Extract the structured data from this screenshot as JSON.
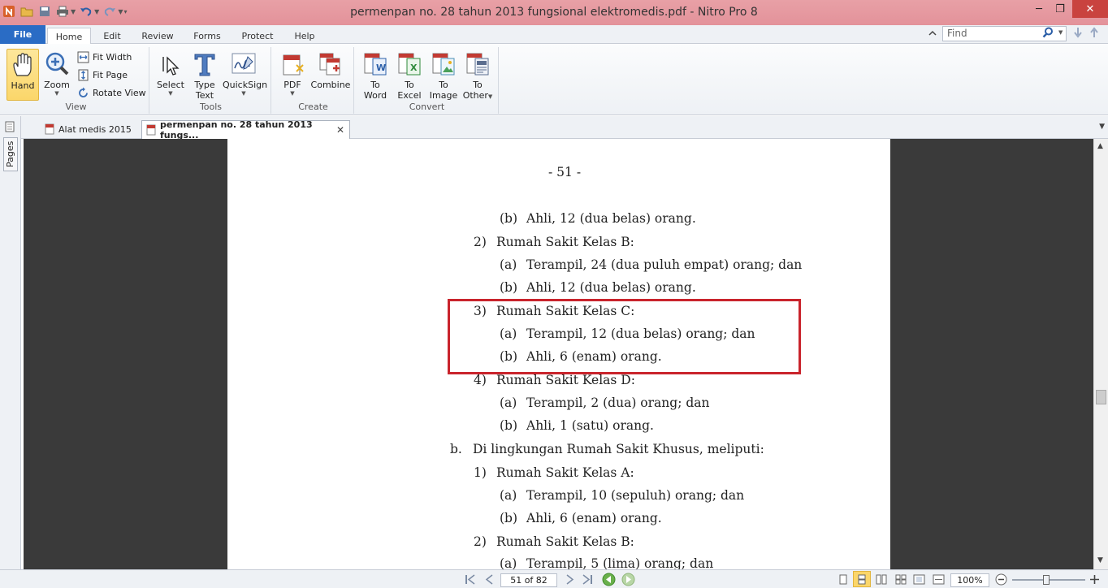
{
  "window": {
    "title": "permenpan no. 28 tahun 2013 fungsional elektromedis.pdf - Nitro Pro 8"
  },
  "menu": {
    "file": "File",
    "tabs": [
      "Home",
      "Edit",
      "Review",
      "Forms",
      "Protect",
      "Help"
    ]
  },
  "search": {
    "placeholder": "Find"
  },
  "ribbon": {
    "view": {
      "label": "View",
      "hand": "Hand",
      "zoom": "Zoom",
      "fit_width": "Fit Width",
      "fit_page": "Fit Page",
      "rotate_view": "Rotate View"
    },
    "tools": {
      "label": "Tools",
      "select": "Select",
      "type_text_1": "Type",
      "type_text_2": "Text",
      "quicksign": "QuickSign"
    },
    "create": {
      "label": "Create",
      "pdf": "PDF",
      "combine": "Combine"
    },
    "convert": {
      "label": "Convert",
      "to": "To",
      "word": "Word",
      "excel": "Excel",
      "image": "Image",
      "other": "Other"
    }
  },
  "side": {
    "pages_tab": "Pages"
  },
  "doc_tabs": [
    {
      "label": "Alat medis 2015"
    },
    {
      "label": "permenpan no. 28 tahun 2013 fungs..."
    }
  ],
  "page": {
    "number": "- 51 -",
    "lines": [
      {
        "marker": "(b)",
        "text": "Ahli, 12 (dua belas) orang."
      },
      {
        "marker": "2)",
        "text": "Rumah Sakit Kelas B:"
      },
      {
        "marker": "(a)",
        "text": "Terampil, 24 (dua puluh empat) orang; dan"
      },
      {
        "marker": "(b)",
        "text": "Ahli, 12 (dua belas) orang."
      },
      {
        "marker": "3)",
        "text": "Rumah Sakit Kelas C:"
      },
      {
        "marker": "(a)",
        "text": "Terampil, 12 (dua belas) orang; dan"
      },
      {
        "marker": "(b)",
        "text": "Ahli, 6 (enam) orang."
      },
      {
        "marker": "4)",
        "text": "Rumah Sakit Kelas D:"
      },
      {
        "marker": "(a)",
        "text": "Terampil, 2 (dua) orang; dan"
      },
      {
        "marker": "(b)",
        "text": "Ahli, 1 (satu) orang."
      },
      {
        "marker": "b.",
        "text": "Di lingkungan Rumah Sakit Khusus, meliputi:"
      },
      {
        "marker": "1)",
        "text": "Rumah Sakit Kelas A:"
      },
      {
        "marker": "(a)",
        "text": "Terampil, 10 (sepuluh) orang; dan"
      },
      {
        "marker": "(b)",
        "text": "Ahli, 6 (enam) orang."
      },
      {
        "marker": "2)",
        "text": "Rumah Sakit Kelas B:"
      },
      {
        "marker": "(a)",
        "text": "Terampil, 5 (lima) orang; dan"
      }
    ]
  },
  "status": {
    "page_indicator": "51 of 82",
    "zoom": "100%"
  },
  "colors": {
    "highlight_box": "#c9242c",
    "file_tab": "#2a6cc5",
    "titlebar": "#e3929a"
  }
}
